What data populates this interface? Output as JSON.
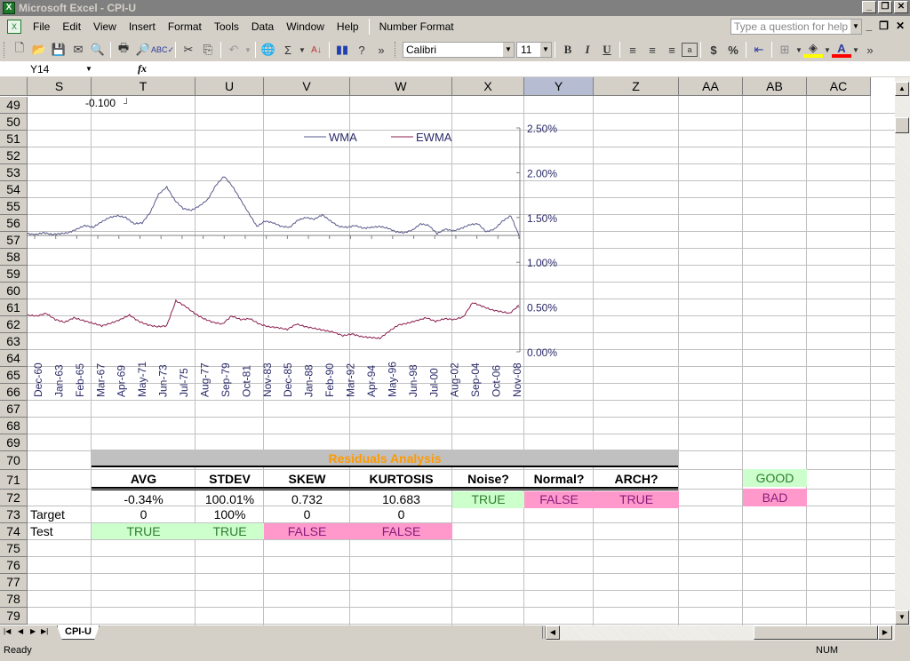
{
  "window": {
    "title": "Microsoft Excel - CPI-U",
    "minimize": "_",
    "restore": "❐",
    "close": "✕"
  },
  "menu": {
    "items": [
      {
        "label": "File",
        "key": "F"
      },
      {
        "label": "Edit",
        "key": "E"
      },
      {
        "label": "View",
        "key": "V"
      },
      {
        "label": "Insert",
        "key": "I"
      },
      {
        "label": "Format",
        "key": "o"
      },
      {
        "label": "Tools",
        "key": "T"
      },
      {
        "label": "Data",
        "key": "D"
      },
      {
        "label": "Window",
        "key": "W"
      },
      {
        "label": "Help",
        "key": "H"
      }
    ],
    "number_format": "Number Format",
    "help_placeholder": "Type a question for help"
  },
  "toolbar": {
    "font": "Calibri",
    "size": "11",
    "bold": "B",
    "italic": "I",
    "underline": "U",
    "currency": "$",
    "percent": "%",
    "sum": "Σ",
    "overflow": "»"
  },
  "formula_bar": {
    "name_box": "Y14",
    "fx": "fx",
    "content": ""
  },
  "columns": [
    "S",
    "T",
    "U",
    "V",
    "W",
    "X",
    "Y",
    "Z",
    "AA",
    "AB",
    "AC"
  ],
  "selected_column": "Y",
  "rows": [
    49,
    50,
    51,
    52,
    53,
    54,
    55,
    56,
    57,
    58,
    59,
    60,
    61,
    62,
    63,
    64,
    65,
    66,
    67,
    68,
    69,
    70,
    71,
    72,
    73,
    74,
    75,
    76,
    77,
    78,
    79
  ],
  "cell_t49": "-0.100",
  "chart_data": {
    "type": "line",
    "title": "",
    "legend": [
      "WMA",
      "EWMA"
    ],
    "legend_position": "top",
    "y_axis_position": "right",
    "yticks": [
      "0.00%",
      "0.50%",
      "1.00%",
      "1.50%",
      "2.00%",
      "2.50%"
    ],
    "ylim": [
      0,
      0.025
    ],
    "xticks": [
      "Dec-60",
      "Jan-63",
      "Feb-65",
      "Mar-67",
      "Apr-69",
      "May-71",
      "Jun-73",
      "Jul-75",
      "Aug-77",
      "Sep-79",
      "Oct-81",
      "Nov-83",
      "Dec-85",
      "Jan-88",
      "Feb-90",
      "Mar-92",
      "Apr-94",
      "May-96",
      "Jun-98",
      "Jul-00",
      "Aug-02",
      "Sep-04",
      "Oct-06",
      "Nov-08"
    ],
    "series": [
      {
        "name": "WMA",
        "color": "#5a5a8c",
        "values": [
          0.0132,
          0.0131,
          0.0133,
          0.0131,
          0.0132,
          0.0133,
          0.0137,
          0.0141,
          0.0139,
          0.0145,
          0.015,
          0.0152,
          0.015,
          0.0143,
          0.0144,
          0.0156,
          0.0176,
          0.0184,
          0.0169,
          0.016,
          0.0158,
          0.0163,
          0.017,
          0.0186,
          0.0196,
          0.0185,
          0.017,
          0.0155,
          0.014,
          0.0146,
          0.0144,
          0.014,
          0.0139,
          0.0147,
          0.015,
          0.0148,
          0.0153,
          0.0146,
          0.014,
          0.0139,
          0.0141,
          0.0138,
          0.0139,
          0.014,
          0.0138,
          0.0134,
          0.0133,
          0.0136,
          0.0143,
          0.0141,
          0.0132,
          0.0137,
          0.0135,
          0.0138,
          0.0142,
          0.0143,
          0.0134,
          0.0137,
          0.0146,
          0.0152,
          0.013
        ]
      },
      {
        "name": "EWMA",
        "color": "#8c1f4f",
        "values": [
          0.0041,
          0.004,
          0.0043,
          0.0036,
          0.0033,
          0.0038,
          0.0035,
          0.0032,
          0.0029,
          0.0032,
          0.0036,
          0.0041,
          0.0034,
          0.003,
          0.0028,
          0.0029,
          0.0057,
          0.0051,
          0.0043,
          0.0037,
          0.0033,
          0.0031,
          0.004,
          0.0036,
          0.0037,
          0.0031,
          0.0028,
          0.0027,
          0.0025,
          0.0031,
          0.0028,
          0.0026,
          0.0024,
          0.0022,
          0.0018,
          0.002,
          0.0017,
          0.0016,
          0.0015,
          0.0023,
          0.003,
          0.0032,
          0.0035,
          0.0038,
          0.0034,
          0.0037,
          0.0036,
          0.0039,
          0.0055,
          0.0051,
          0.0047,
          0.0045,
          0.0043,
          0.0052
        ]
      }
    ]
  },
  "residuals": {
    "title": "Residuals Analysis",
    "headers": [
      "AVG",
      "STDEV",
      "SKEW",
      "KURTOSIS",
      "Noise?",
      "Normal?",
      "ARCH?"
    ],
    "values": [
      "-0.34%",
      "100.01%",
      "0.732",
      "10.683"
    ],
    "flags": [
      "TRUE",
      "FALSE",
      "TRUE"
    ],
    "target_label": "Target",
    "targets": [
      "0",
      "100%",
      "0",
      "0"
    ],
    "test_label": "Test",
    "tests": [
      "TRUE",
      "TRUE",
      "FALSE",
      "FALSE"
    ]
  },
  "legend_key": {
    "good": "GOOD",
    "bad": "BAD"
  },
  "colors": {
    "good_bg": "#ccffcc",
    "good_fg": "#2e7d2e",
    "bad_bg": "#ff99cc",
    "bad_fg": "#8b1a7a",
    "header_bg": "#c0c0c0",
    "title_fg": "#ff9900"
  },
  "sheet_tabs": [
    "CPI-U"
  ],
  "status": {
    "left": "Ready",
    "num": "NUM"
  }
}
